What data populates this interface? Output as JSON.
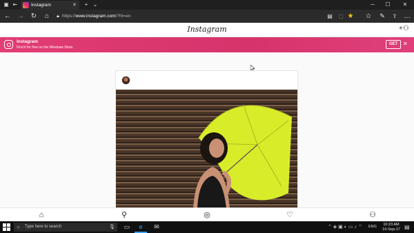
{
  "browser": {
    "tab_title": "Instagram",
    "url_prefix": "https://",
    "url_domain": "www.instagram.com",
    "url_path": "/?hl=en",
    "icons": [
      "tab-list-icon",
      "back-tab-icon",
      "close-icon",
      "plus-icon",
      "chevron-down-icon",
      "back-icon",
      "forward-icon",
      "refresh-icon",
      "home-icon",
      "lock-icon",
      "reading-view-icon",
      "favorite-star-icon",
      "favorites-hub-icon",
      "pen-icon",
      "share-icon",
      "more-icon"
    ]
  },
  "instagram": {
    "logo": "Instagram",
    "banner": {
      "app_name": "Instagram",
      "subtitle": "Find it for free on the Windows Store.",
      "get_label": "GET"
    }
  },
  "taskbar": {
    "search_placeholder": "Type here to search",
    "language": "ENG",
    "time": "10:23 AM",
    "date": "10-Sep-17"
  },
  "colors": {
    "banner": "#e0407a",
    "umbrella": "#d8ec2a",
    "taskbar": "#101010",
    "titlebar": "#1f1f1f"
  }
}
